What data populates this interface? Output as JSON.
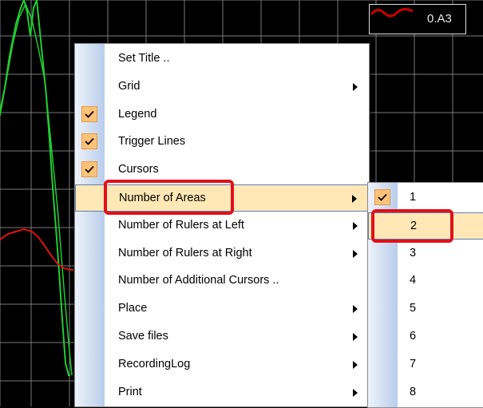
{
  "legend": {
    "text": "0.A3",
    "swatch_color": "#cc0000"
  },
  "colors": {
    "scope_bg": "#000000",
    "grid": "#7a7a7a",
    "trace_green": "#22cc33",
    "trace_red": "#dd1111",
    "highlight": "#ffe8b5",
    "check_bg": "#ffc27a",
    "callout": "#e0101a"
  },
  "context_menu": {
    "items": [
      {
        "label": "Set Title ..",
        "checked": false,
        "submenu": false
      },
      {
        "label": "Grid",
        "checked": false,
        "submenu": true
      },
      {
        "label": "Legend",
        "checked": true,
        "submenu": false
      },
      {
        "label": "Trigger Lines",
        "checked": true,
        "submenu": false
      },
      {
        "label": "Cursors",
        "checked": true,
        "submenu": false
      },
      {
        "label": "Number of Areas",
        "checked": false,
        "submenu": true,
        "highlighted": true
      },
      {
        "label": "Number of Rulers at Left",
        "checked": false,
        "submenu": true
      },
      {
        "label": "Number of Rulers at Right",
        "checked": false,
        "submenu": true
      },
      {
        "label": "Number of Additional Cursors ..",
        "checked": false,
        "submenu": false
      },
      {
        "label": "Place",
        "checked": false,
        "submenu": true
      },
      {
        "label": "Save files",
        "checked": false,
        "submenu": true
      },
      {
        "label": "RecordingLog",
        "checked": false,
        "submenu": true
      },
      {
        "label": "Print",
        "checked": false,
        "submenu": true
      }
    ]
  },
  "submenu": {
    "items": [
      {
        "label": "1",
        "checked": true
      },
      {
        "label": "2",
        "checked": false,
        "highlighted": true
      },
      {
        "label": "3",
        "checked": false
      },
      {
        "label": "4",
        "checked": false
      },
      {
        "label": "5",
        "checked": false
      },
      {
        "label": "6",
        "checked": false
      },
      {
        "label": "7",
        "checked": false
      },
      {
        "label": "8",
        "checked": false
      }
    ]
  }
}
